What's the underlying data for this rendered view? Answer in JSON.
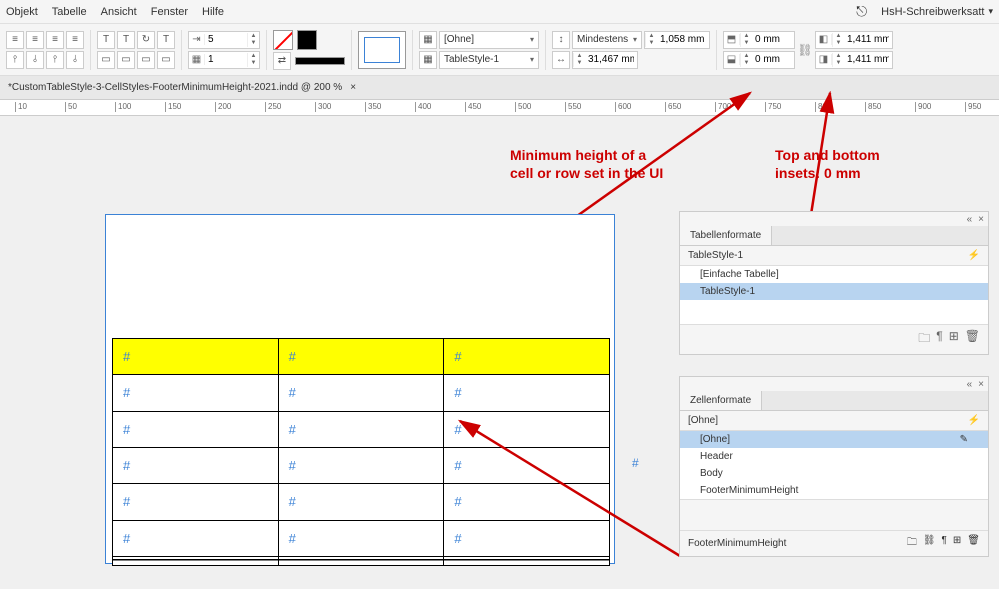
{
  "menu": {
    "items": [
      "Objekt",
      "Tabelle",
      "Ansicht",
      "Fenster",
      "Hilfe"
    ],
    "workspace": "HsH-Schreibwerksatt"
  },
  "toolbar": {
    "indent": "5",
    "rows": "1",
    "style_dd1": "[Ohne]",
    "style_dd2": "TableStyle-1",
    "height_mode": "Mindestens",
    "row_h": "1,058 mm",
    "col_w": "31,467 mm",
    "inset_top": "0 mm",
    "inset_bottom": "0 mm",
    "inset_left": "1,411 mm",
    "inset_right": "1,411 mm"
  },
  "doc": {
    "tab": "*CustomTableStyle-3-CellStyles-FooterMinimumHeight-2021.indd @ 200 %"
  },
  "ruler_ticks": [
    10,
    50,
    100,
    150,
    200,
    250,
    300,
    350,
    400,
    450,
    500,
    550,
    600,
    650,
    700,
    750,
    800,
    850,
    900,
    950
  ],
  "annotations": {
    "a1": "Minimum height of a\ncell or row set in the UI",
    "a2": "Top and bottom\ninsets: 0 mm"
  },
  "table": {
    "cell": "#",
    "cols": 3,
    "body_rows": 5
  },
  "panel1": {
    "title": "Tabellenformate",
    "active": "TableStyle-1",
    "items": [
      "[Einfache Tabelle]",
      "TableStyle-1"
    ]
  },
  "panel2": {
    "title": "Zellenformate",
    "active": "[Ohne]",
    "items": [
      "[Ohne]",
      "Header",
      "Body",
      "FooterMinimumHeight"
    ],
    "status": "FooterMinimumHeight"
  }
}
